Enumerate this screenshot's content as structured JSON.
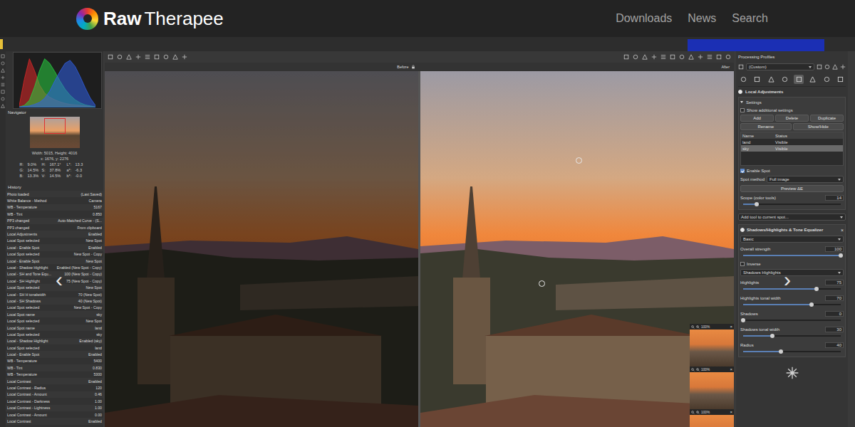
{
  "site": {
    "brand_bold": "Raw",
    "brand_light": "Therapee",
    "nav": [
      {
        "label": "Downloads"
      },
      {
        "label": "News"
      },
      {
        "label": "Search"
      }
    ]
  },
  "carousel": {
    "prev": "‹",
    "next": "›"
  },
  "histogram": {
    "series": [
      {
        "name": "red",
        "color": "#e02828",
        "values": [
          4,
          55,
          95,
          72,
          44,
          28,
          20,
          15,
          11,
          8,
          6,
          5,
          4,
          3,
          2,
          1
        ]
      },
      {
        "name": "green",
        "color": "#28d040",
        "values": [
          1,
          4,
          14,
          40,
          72,
          95,
          86,
          70,
          52,
          36,
          24,
          15,
          9,
          5,
          3,
          1
        ]
      },
      {
        "name": "blue",
        "color": "#3060e8",
        "values": [
          1,
          2,
          3,
          6,
          10,
          18,
          32,
          52,
          70,
          86,
          92,
          80,
          60,
          38,
          18,
          4
        ]
      }
    ]
  },
  "navigator": {
    "title": "Navigator",
    "size": "Width: 5015, Height: 4016",
    "cursor": "x: 1676, y: 2276",
    "readouts": [
      {
        "cells": [
          "R:",
          "9.0%",
          "H:",
          "167.1°",
          "L*:",
          "13.3"
        ]
      },
      {
        "cells": [
          "G:",
          "14.5%",
          "S:",
          "37.8%",
          "a*:",
          "-6.3"
        ]
      },
      {
        "cells": [
          "B:",
          "13.3%",
          "V:",
          "14.5%",
          "b*:",
          "-0.0"
        ]
      }
    ]
  },
  "history": {
    "title": "History",
    "rows": [
      {
        "action": "Photo loaded",
        "value": "(Last Saved)",
        "selected": false
      },
      {
        "action": "White Balance - Method",
        "value": "Camera",
        "selected": false
      },
      {
        "action": "WB - Temperature",
        "value": "5167",
        "selected": false
      },
      {
        "action": "WB - Tint",
        "value": "0.850",
        "selected": false
      },
      {
        "action": "PP3 changed",
        "value": "Auto-Matched Curve - (S...",
        "selected": false
      },
      {
        "action": "PP3 changed",
        "value": "From clipboard",
        "selected": false
      },
      {
        "action": "Local Adjustments",
        "value": "Enabled",
        "selected": false
      },
      {
        "action": "Local Spot selected",
        "value": "New Spot",
        "selected": false
      },
      {
        "action": "Local - Enable Spot",
        "value": "Enabled",
        "selected": false
      },
      {
        "action": "Local Spot selected",
        "value": "New Spot - Copy",
        "selected": false
      },
      {
        "action": "Local - Enable Spot",
        "value": "New Spot",
        "selected": false
      },
      {
        "action": "Local - Shadow Highlight",
        "value": "Enabled (New Spot - Copy)",
        "selected": false
      },
      {
        "action": "Local - SH and Tone Equ...",
        "value": "100 (New Spot - Copy)",
        "selected": false
      },
      {
        "action": "Local - SH Highlight",
        "value": "75 (New Spot - Copy)",
        "selected": false
      },
      {
        "action": "Local Spot selected",
        "value": "New Spot",
        "selected": false
      },
      {
        "action": "Local - SH H tonalwidth",
        "value": "70 (New Spot)",
        "selected": false
      },
      {
        "action": "Local - SH Shadows",
        "value": "40 (New Spot)",
        "selected": false
      },
      {
        "action": "Local Spot selected",
        "value": "New Spot - Copy",
        "selected": false
      },
      {
        "action": "Local Spot name",
        "value": "sky",
        "selected": false
      },
      {
        "action": "Local Spot selected",
        "value": "New Spot",
        "selected": false
      },
      {
        "action": "Local Spot name",
        "value": "land",
        "selected": false
      },
      {
        "action": "Local Spot selected",
        "value": "sky",
        "selected": false
      },
      {
        "action": "Local - Shadow Highlight",
        "value": "Enabled (sky)",
        "selected": false
      },
      {
        "action": "Local Spot selected",
        "value": "land",
        "selected": false
      },
      {
        "action": "Local - Enable Spot",
        "value": "Enabled",
        "selected": false
      },
      {
        "action": "WB - Temperature",
        "value": "5400",
        "selected": false
      },
      {
        "action": "WB - Tint",
        "value": "0.830",
        "selected": false
      },
      {
        "action": "WB - Temperature",
        "value": "5300",
        "selected": false
      },
      {
        "action": "Local Contrast",
        "value": "Enabled",
        "selected": false
      },
      {
        "action": "Local Contrast - Radius",
        "value": "120",
        "selected": false
      },
      {
        "action": "Local Contrast - Amount",
        "value": "0.46",
        "selected": false
      },
      {
        "action": "Local Contrast - Darkness",
        "value": "1.00",
        "selected": false
      },
      {
        "action": "Local Contrast - Lightness",
        "value": "1.00",
        "selected": false
      },
      {
        "action": "Local Contrast - Amount",
        "value": "0.00",
        "selected": false
      },
      {
        "action": "Local Contrast",
        "value": "Enabled",
        "selected": false
      }
    ]
  },
  "viewer": {
    "before": "Before",
    "after": "After",
    "previews": [
      {
        "zoom": "100%",
        "close": "×"
      },
      {
        "zoom": "100%",
        "close": "×"
      },
      {
        "zoom": "100%",
        "close": "×"
      }
    ]
  },
  "profiles": {
    "title": "Processing Profiles",
    "value": "(Custom)"
  },
  "tool_tabs": [
    {
      "selected": false
    },
    {
      "selected": false
    },
    {
      "selected": false
    },
    {
      "selected": false
    },
    {
      "selected": true
    },
    {
      "selected": false
    },
    {
      "selected": false
    },
    {
      "selected": false
    }
  ],
  "local": {
    "title": "Local Adjustments",
    "enabled": true
  },
  "settings": {
    "title": "Settings",
    "expanded": true
  },
  "show_additional": {
    "label": "Show additional settings",
    "checked": false
  },
  "button_rows": [
    {
      "buttons": [
        "Add",
        "Delete",
        "Duplicate"
      ]
    },
    {
      "buttons": [
        "Rename",
        "Show/Hide"
      ]
    }
  ],
  "spots": {
    "columns": [
      "Name",
      "Status"
    ],
    "rows": [
      {
        "name": "land",
        "status": "Visible",
        "selected": false
      },
      {
        "name": "sky",
        "status": "Visible",
        "selected": true
      }
    ]
  },
  "enable_spot": {
    "label": "Enable Spot",
    "checked": true
  },
  "spot_method": {
    "label": "Spot method",
    "value": "Full image"
  },
  "preview_button": "Preview ΔE",
  "scope": {
    "label": "Scope (color tools)",
    "value": "14",
    "level": 0.14
  },
  "add_tool": "Add tool to current spot...",
  "tool": {
    "title": "Shadows/Highlights & Tone Equalizer",
    "enabled": true,
    "close": "×",
    "controls": [
      {
        "kind": "combo",
        "value": "Basic"
      },
      {
        "kind": "slider",
        "label": "Overall strength",
        "value": "100",
        "level": 1
      },
      {
        "kind": "checkbox",
        "label": "Inverse",
        "checked": false
      },
      {
        "kind": "combo",
        "value": "Shadows Highlights"
      },
      {
        "kind": "slider",
        "label": "Highlights",
        "value": "75",
        "level": 0.75
      },
      {
        "kind": "slider",
        "label": "Highlights tonal width",
        "value": "70",
        "level": 0.7
      },
      {
        "kind": "slider",
        "label": "Shadows",
        "value": "0",
        "level": 0
      },
      {
        "kind": "slider",
        "label": "Shadows tonal width",
        "value": "30",
        "level": 0.3
      },
      {
        "kind": "slider",
        "label": "Radius",
        "value": "40",
        "level": 0.39
      }
    ]
  }
}
